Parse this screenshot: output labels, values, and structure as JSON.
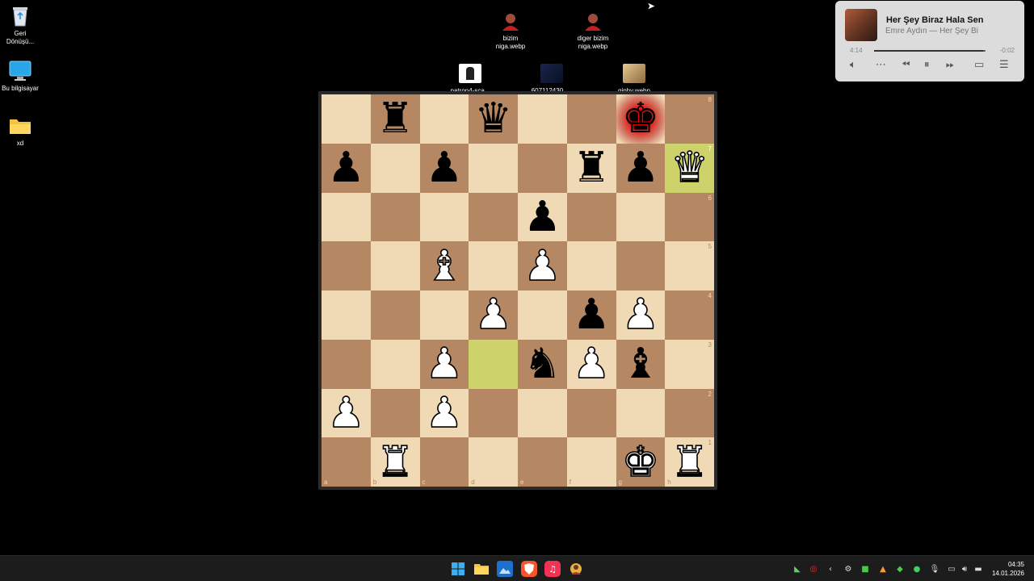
{
  "desktop": {
    "icons": [
      {
        "name": "recycle-bin-icon",
        "label": "Geri\nDönüşü..."
      },
      {
        "name": "this-pc-icon",
        "label": "Bu bilgisayar"
      },
      {
        "name": "folder-xd-icon",
        "label": "xd"
      },
      {
        "name": "file-bizim-niga",
        "label": "bizim\nniga.webp"
      },
      {
        "name": "file-diger-bizim-niga",
        "label": "diger bizim\nniga.webp"
      },
      {
        "name": "file-patron4",
        "label": "patron4-sca..."
      },
      {
        "name": "file-607112430",
        "label": "607112430_..."
      },
      {
        "name": "file-giphy",
        "label": "giphy.webp"
      }
    ]
  },
  "board": {
    "check_square": "g8",
    "highlight_squares": [
      "h7",
      "d3"
    ],
    "ranks": [
      [
        "",
        "r",
        "",
        "q",
        "",
        "",
        "k",
        ""
      ],
      [
        "p",
        "",
        "p",
        "",
        "",
        "r",
        "p",
        "Q"
      ],
      [
        "",
        "",
        "",
        "",
        "p",
        "",
        "",
        ""
      ],
      [
        "",
        "",
        "B",
        "",
        "P",
        "",
        "",
        ""
      ],
      [
        "",
        "",
        "",
        "P",
        "",
        "p",
        "P",
        ""
      ],
      [
        "",
        "",
        "P",
        "",
        "n",
        "P",
        "b",
        ""
      ],
      [
        "P",
        "",
        "P",
        "",
        "",
        "",
        "",
        ""
      ],
      [
        "",
        "R",
        "",
        "",
        "",
        "",
        "K",
        "R"
      ]
    ],
    "rank_labels": [
      "8",
      "7",
      "6",
      "5",
      "4",
      "3",
      "2",
      "1"
    ],
    "file_labels": [
      "a",
      "b",
      "c",
      "d",
      "e",
      "f",
      "g",
      "h"
    ]
  },
  "media": {
    "title": "Her Şey Biraz Hala Sen",
    "artist": "Emre Aydın — Her Şey Bi",
    "elapsed": "4:14",
    "remaining": "-0:02",
    "progress": 0.98
  },
  "taskbar": {
    "time": "04:35",
    "date": "14.01.2026"
  },
  "colors": {
    "light_square": "#f0d9b5",
    "dark_square": "#b58863",
    "highlight": "#cdd26a",
    "check": "#ff0000"
  }
}
